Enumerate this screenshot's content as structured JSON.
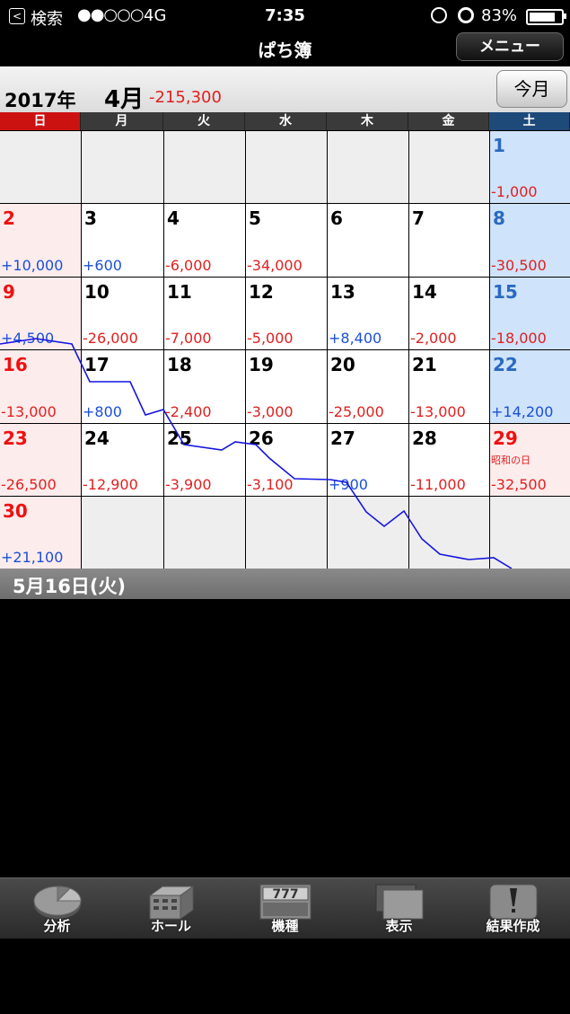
{
  "status": {
    "back_label": "検索",
    "signal": "●●○○○",
    "network": "4G",
    "time": "7:35",
    "battery": "83%",
    "battery_level": 0.83
  },
  "nav": {
    "title": "ぱち簿",
    "menu_label": "メニュー"
  },
  "month_header": {
    "year": "2017年",
    "month": "4月",
    "total": "-215,300",
    "today_label": "今月"
  },
  "weekdays": [
    "日",
    "月",
    "火",
    "水",
    "木",
    "金",
    "土"
  ],
  "calendar": {
    "rows": [
      [
        null,
        null,
        null,
        null,
        null,
        null,
        {
          "day": "1",
          "amount": "-1,000"
        }
      ],
      [
        {
          "day": "2",
          "amount": "+10,000"
        },
        {
          "day": "3",
          "amount": "+600"
        },
        {
          "day": "4",
          "amount": "-6,000"
        },
        {
          "day": "5",
          "amount": "-34,000"
        },
        {
          "day": "6",
          "amount": ""
        },
        {
          "day": "7",
          "amount": ""
        },
        {
          "day": "8",
          "amount": "-30,500"
        }
      ],
      [
        {
          "day": "9",
          "amount": "+4,500"
        },
        {
          "day": "10",
          "amount": "-26,000"
        },
        {
          "day": "11",
          "amount": "-7,000"
        },
        {
          "day": "12",
          "amount": "-5,000"
        },
        {
          "day": "13",
          "amount": "+8,400"
        },
        {
          "day": "14",
          "amount": "-2,000"
        },
        {
          "day": "15",
          "amount": "-18,000"
        }
      ],
      [
        {
          "day": "16",
          "amount": "-13,000"
        },
        {
          "day": "17",
          "amount": "+800"
        },
        {
          "day": "18",
          "amount": "-2,400"
        },
        {
          "day": "19",
          "amount": "-3,000"
        },
        {
          "day": "20",
          "amount": "-25,000"
        },
        {
          "day": "21",
          "amount": "-13,000"
        },
        {
          "day": "22",
          "amount": "+14,200"
        }
      ],
      [
        {
          "day": "23",
          "amount": "-26,500"
        },
        {
          "day": "24",
          "amount": "-12,900"
        },
        {
          "day": "25",
          "amount": "-3,900"
        },
        {
          "day": "26",
          "amount": "-3,100"
        },
        {
          "day": "27",
          "amount": "+900"
        },
        {
          "day": "28",
          "amount": "-11,000"
        },
        {
          "day": "29",
          "amount": "-32,500",
          "holiday": "昭和の日"
        }
      ],
      [
        {
          "day": "30",
          "amount": "+21,100"
        },
        null,
        null,
        null,
        null,
        null,
        null
      ]
    ]
  },
  "trend_color": "#1515e0",
  "selected_date": "5月16日(火)",
  "tabs": [
    {
      "label": "分析",
      "icon": "pie-chart-icon"
    },
    {
      "label": "ホール",
      "icon": "building-icon"
    },
    {
      "label": "機種",
      "icon": "slot-machine-icon"
    },
    {
      "label": "表示",
      "icon": "window-icon"
    },
    {
      "label": "結果作成",
      "icon": "pen-icon"
    }
  ]
}
